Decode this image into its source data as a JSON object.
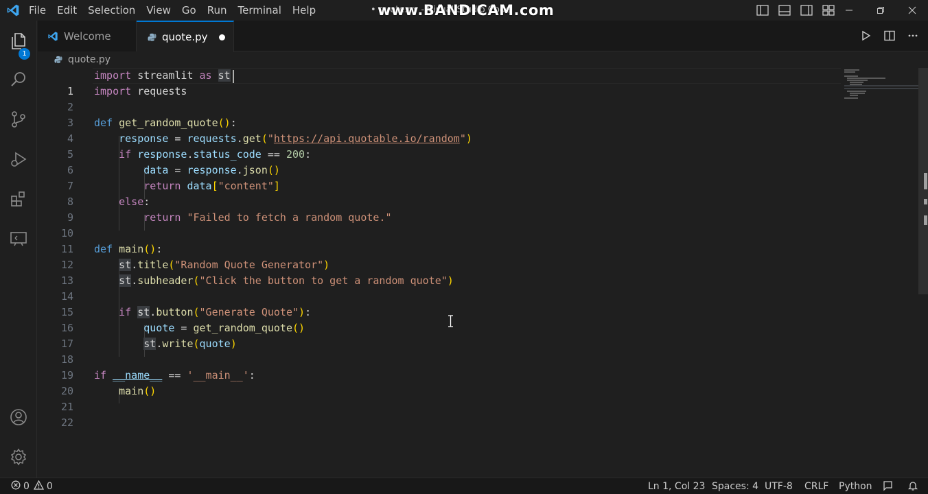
{
  "titlebar": {
    "menus": [
      "File",
      "Edit",
      "Selection",
      "View",
      "Go",
      "Run",
      "Terminal",
      "Help"
    ],
    "window_title": "• quote.py - Visual Studio Code",
    "watermark": "www.BANDICAM.com"
  },
  "activitybar": {
    "items": [
      "explorer-icon",
      "search-icon",
      "source-control-icon",
      "run-debug-icon",
      "extensions-icon",
      "remote-explorer-icon"
    ],
    "explorer_badge": "1",
    "bottom_items": [
      "account-icon",
      "gear-icon"
    ]
  },
  "tabs": [
    {
      "label": "Welcome",
      "active": false
    },
    {
      "label": "quote.py",
      "active": true,
      "dirty": true
    }
  ],
  "breadcrumb": {
    "file": "quote.py"
  },
  "editor": {
    "active_line": 1,
    "lines": [
      "1",
      "2",
      "3",
      "4",
      "5",
      "6",
      "7",
      "8",
      "9",
      "10",
      "11",
      "12",
      "13",
      "14",
      "15",
      "16",
      "17",
      "18",
      "19",
      "20",
      "21",
      "22"
    ],
    "code": {
      "l1": {
        "a": "import",
        "b": " streamlit ",
        "c": "as",
        "d": " ",
        "e": "st"
      },
      "l2": {
        "a": "import",
        "b": " requests"
      },
      "l4": {
        "a": "def",
        "b": " ",
        "c": "get_random_quote",
        "d": "()",
        "e": ":"
      },
      "l5": {
        "a": "response",
        "b": " = ",
        "c": "requests",
        "d": ".",
        "e": "get",
        "f": "(",
        "g": "\"",
        "h": "https://api.quotable.io/random",
        "i": "\"",
        "j": ")"
      },
      "l6": {
        "a": "if",
        "b": " ",
        "c": "response",
        "d": ".",
        "e": "status_code",
        "f": " == ",
        "g": "200",
        "h": ":"
      },
      "l7": {
        "a": "data",
        "b": " = ",
        "c": "response",
        "d": ".",
        "e": "json",
        "f": "()"
      },
      "l8": {
        "a": "return",
        "b": " ",
        "c": "data",
        "d": "[",
        "e": "\"content\"",
        "f": "]"
      },
      "l9": {
        "a": "else",
        "b": ":"
      },
      "l10": {
        "a": "return",
        "b": " ",
        "c": "\"Failed to fetch a random quote.\""
      },
      "l12": {
        "a": "def",
        "b": " ",
        "c": "main",
        "d": "()",
        "e": ":"
      },
      "l13": {
        "a": "st",
        "b": ".",
        "c": "title",
        "d": "(",
        "e": "\"Random Quote Generator\"",
        "f": ")"
      },
      "l14": {
        "a": "st",
        "b": ".",
        "c": "subheader",
        "d": "(",
        "e": "\"Click the button to get a random quote\"",
        "f": ")"
      },
      "l16": {
        "a": "if",
        "b": " ",
        "c": "st",
        "d": ".",
        "e": "button",
        "f": "(",
        "g": "\"Generate Quote\"",
        "h": ")",
        "i": ":"
      },
      "l17": {
        "a": "quote",
        "b": " = ",
        "c": "get_random_quote",
        "d": "()"
      },
      "l18": {
        "a": "st",
        "b": ".",
        "c": "write",
        "d": "(",
        "e": "quote",
        "f": ")"
      },
      "l20": {
        "a": "if",
        "b": " ",
        "c": "__name__",
        "d": " == ",
        "e": "'__main__'",
        "f": ":"
      },
      "l21": {
        "a": "main",
        "b": "()"
      }
    }
  },
  "statusbar": {
    "errors": "0",
    "warnings": "0",
    "position": "Ln 1, Col 23",
    "spaces": "Spaces: 4",
    "encoding": "UTF-8",
    "eol": "CRLF",
    "language": "Python"
  },
  "colors": {
    "accent": "#0078d4",
    "keyword": "#569cd6",
    "control": "#c586c0",
    "function": "#dcdcaa",
    "variable": "#9cdcfe",
    "string": "#ce9178",
    "number": "#b5cea8"
  }
}
